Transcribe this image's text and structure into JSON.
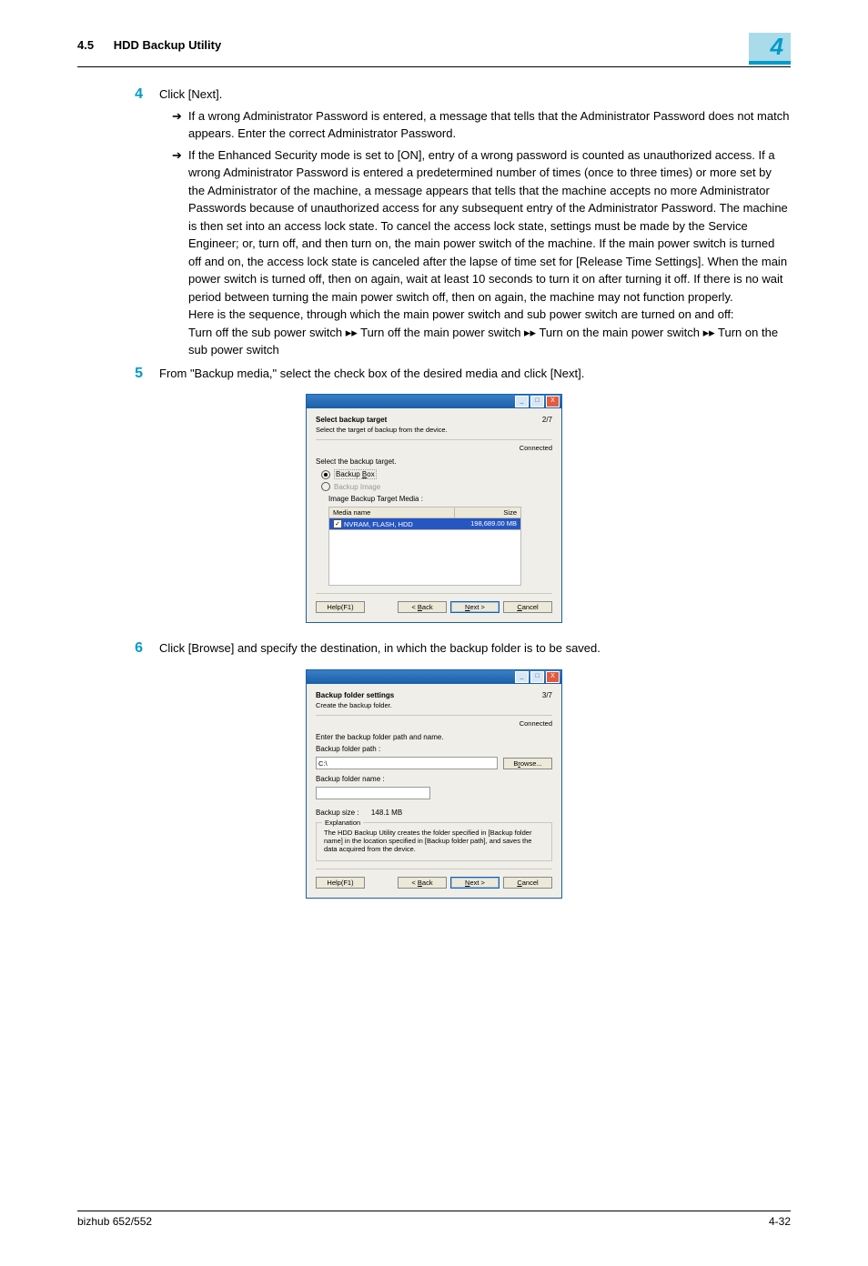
{
  "header": {
    "section": "4.5",
    "title": "HDD Backup Utility",
    "chapter": "4"
  },
  "step4": {
    "num": "4",
    "text": "Click [Next].",
    "bullet1": "If a wrong Administrator Password is entered, a message that tells that the Administrator Password does not match appears. Enter the correct Administrator Password.",
    "bullet2_a": "If the Enhanced Security mode is set to [ON], entry of a wrong password is counted as unauthorized access. If a wrong Administrator Password is entered a predetermined number of times (once to three times) or more set by the Administrator of the machine, a message appears that tells that the machine accepts no more Administrator Passwords because of unauthorized access for any subsequent entry of the Administrator Password. The machine is then set into an access lock state. To cancel the access lock state, settings must be made by the Service Engineer; or, turn off, and then turn on, the main power switch of the machine. If the main power switch is turned off and on, the access lock state is canceled after the lapse of time set for [Release Time Settings]. When the main power switch is turned off, then on again, wait at least 10 seconds to turn it on after turning it off. If there is no wait period between turning the main power switch off, then on again, the machine may not function properly.",
    "bullet2_b": "Here is the sequence, through which the main power switch and sub power switch are turned on and off:",
    "bullet2_c": "Turn off the sub power switch ▸▸ Turn off the main power switch ▸▸ Turn on the main power switch ▸▸ Turn on the sub power switch"
  },
  "step5": {
    "num": "5",
    "text": "From \"Backup media,\" select the check box of the desired media and click [Next]."
  },
  "step6": {
    "num": "6",
    "text": "Click [Browse] and specify the destination, in which the backup folder is to be saved."
  },
  "dialog1": {
    "title": "Select backup target",
    "subtitle": "Select the target of backup from the device.",
    "step": "2/7",
    "connected": "Connected",
    "select_label": "Select the backup target.",
    "radio1_pre": "Backup ",
    "radio1_u": "B",
    "radio1_post": "ox",
    "radio2": "Backup Image",
    "table_label_pre": "Image Backup Target ",
    "table_label_u": "M",
    "table_label_post": "edia :",
    "col1": "Media name",
    "col2_u": "S",
    "col2_post": "ize",
    "row1_name": "NVRAM, FLASH, HDD",
    "row1_size": "198,689.00 MB",
    "help": "Help(F1)",
    "back_pre": "< ",
    "back_u": "B",
    "back_post": "ack",
    "next_u": "N",
    "next_post": "ext >",
    "cancel_u": "C",
    "cancel_post": "ancel"
  },
  "dialog2": {
    "title": "Backup folder settings",
    "subtitle": "Create the backup folder.",
    "step": "3/7",
    "connected": "Connected",
    "intro": "Enter the backup folder path and name.",
    "path_label_pre": "Backup folder ",
    "path_label_u": "p",
    "path_label_post": "ath :",
    "path_value": "C:\\",
    "browse_pre": "B",
    "browse_u": "r",
    "browse_post": "owse...",
    "name_label_pre": "B",
    "name_label_u": "a",
    "name_label_post": "ckup folder name :",
    "size_label": "Backup size :",
    "size_value": "148.1 MB",
    "legend": "Explanation",
    "explanation": "The HDD Backup Utility creates the folder specified in [Backup folder name] in the location specified in [Backup folder path], and saves the data acquired from the device.",
    "help": "Help(F1)",
    "back_pre": "< ",
    "back_u": "B",
    "back_post": "ack",
    "next_u": "N",
    "next_post": "ext >",
    "cancel_u": "C",
    "cancel_post": "ancel"
  },
  "footer": {
    "left": "bizhub 652/552",
    "right": "4-32"
  }
}
